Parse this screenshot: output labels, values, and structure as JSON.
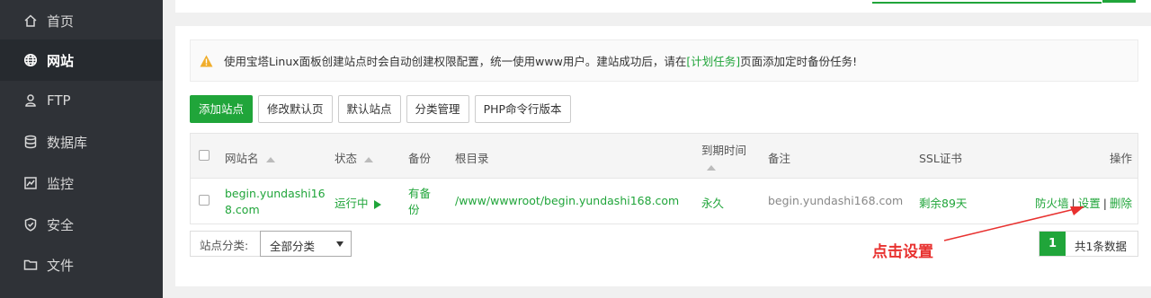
{
  "sidebar": {
    "items": [
      {
        "label": "首页",
        "icon": "home-icon"
      },
      {
        "label": "网站",
        "icon": "globe-icon",
        "active": true
      },
      {
        "label": "FTP",
        "icon": "ftp-icon"
      },
      {
        "label": "数据库",
        "icon": "database-icon"
      },
      {
        "label": "监控",
        "icon": "monitor-icon"
      },
      {
        "label": "安全",
        "icon": "shield-icon"
      },
      {
        "label": "文件",
        "icon": "folder-icon"
      }
    ]
  },
  "notice": {
    "text_before": "使用宝塔Linux面板创建站点时会自动创建权限配置，统一使用www用户。建站成功后，请在",
    "link": "[计划任务]",
    "text_after": "页面添加定时备份任务!"
  },
  "toolbar": {
    "add_site": "添加站点",
    "edit_default_page": "修改默认页",
    "default_site": "默认站点",
    "category_manage": "分类管理",
    "php_cli_version": "PHP命令行版本"
  },
  "table": {
    "headers": {
      "site_name": "网站名",
      "status": "状态",
      "backup": "备份",
      "root_dir": "根目录",
      "expire": "到期时间",
      "remark": "备注",
      "ssl": "SSL证书",
      "actions": "操作"
    },
    "rows": [
      {
        "site_name_line1": "begin.yundashi16",
        "site_name_line2": "8.com",
        "status": "运行中",
        "backup_line1": "有备",
        "backup_line2": "份",
        "root_dir": "/www/wwwroot/begin.yundashi168.com",
        "expire": "永久",
        "remark": "begin.yundashi168.com",
        "ssl": "剩余89天",
        "action_firewall": "防火墙",
        "action_settings": "设置",
        "action_delete": "删除"
      }
    ]
  },
  "footer": {
    "category_label": "站点分类:",
    "category_selected": "全部分类",
    "current_page": "1",
    "total_text": "共1条数据"
  },
  "annotation": {
    "text": "点击设置",
    "color": "#e8312f"
  },
  "colors": {
    "accent": "#20a53a",
    "sidebar_bg": "#2f3237"
  }
}
